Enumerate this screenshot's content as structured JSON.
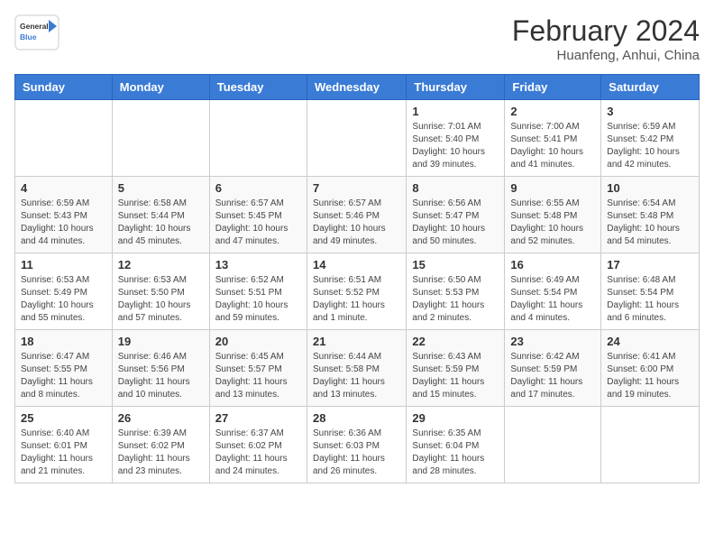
{
  "header": {
    "logo_general": "General",
    "logo_blue": "Blue",
    "month_year": "February 2024",
    "location": "Huanfeng, Anhui, China"
  },
  "days_of_week": [
    "Sunday",
    "Monday",
    "Tuesday",
    "Wednesday",
    "Thursday",
    "Friday",
    "Saturday"
  ],
  "weeks": [
    [
      {
        "day": "",
        "info": ""
      },
      {
        "day": "",
        "info": ""
      },
      {
        "day": "",
        "info": ""
      },
      {
        "day": "",
        "info": ""
      },
      {
        "day": "1",
        "info": "Sunrise: 7:01 AM\nSunset: 5:40 PM\nDaylight: 10 hours and 39 minutes."
      },
      {
        "day": "2",
        "info": "Sunrise: 7:00 AM\nSunset: 5:41 PM\nDaylight: 10 hours and 41 minutes."
      },
      {
        "day": "3",
        "info": "Sunrise: 6:59 AM\nSunset: 5:42 PM\nDaylight: 10 hours and 42 minutes."
      }
    ],
    [
      {
        "day": "4",
        "info": "Sunrise: 6:59 AM\nSunset: 5:43 PM\nDaylight: 10 hours and 44 minutes."
      },
      {
        "day": "5",
        "info": "Sunrise: 6:58 AM\nSunset: 5:44 PM\nDaylight: 10 hours and 45 minutes."
      },
      {
        "day": "6",
        "info": "Sunrise: 6:57 AM\nSunset: 5:45 PM\nDaylight: 10 hours and 47 minutes."
      },
      {
        "day": "7",
        "info": "Sunrise: 6:57 AM\nSunset: 5:46 PM\nDaylight: 10 hours and 49 minutes."
      },
      {
        "day": "8",
        "info": "Sunrise: 6:56 AM\nSunset: 5:47 PM\nDaylight: 10 hours and 50 minutes."
      },
      {
        "day": "9",
        "info": "Sunrise: 6:55 AM\nSunset: 5:48 PM\nDaylight: 10 hours and 52 minutes."
      },
      {
        "day": "10",
        "info": "Sunrise: 6:54 AM\nSunset: 5:48 PM\nDaylight: 10 hours and 54 minutes."
      }
    ],
    [
      {
        "day": "11",
        "info": "Sunrise: 6:53 AM\nSunset: 5:49 PM\nDaylight: 10 hours and 55 minutes."
      },
      {
        "day": "12",
        "info": "Sunrise: 6:53 AM\nSunset: 5:50 PM\nDaylight: 10 hours and 57 minutes."
      },
      {
        "day": "13",
        "info": "Sunrise: 6:52 AM\nSunset: 5:51 PM\nDaylight: 10 hours and 59 minutes."
      },
      {
        "day": "14",
        "info": "Sunrise: 6:51 AM\nSunset: 5:52 PM\nDaylight: 11 hours and 1 minute."
      },
      {
        "day": "15",
        "info": "Sunrise: 6:50 AM\nSunset: 5:53 PM\nDaylight: 11 hours and 2 minutes."
      },
      {
        "day": "16",
        "info": "Sunrise: 6:49 AM\nSunset: 5:54 PM\nDaylight: 11 hours and 4 minutes."
      },
      {
        "day": "17",
        "info": "Sunrise: 6:48 AM\nSunset: 5:54 PM\nDaylight: 11 hours and 6 minutes."
      }
    ],
    [
      {
        "day": "18",
        "info": "Sunrise: 6:47 AM\nSunset: 5:55 PM\nDaylight: 11 hours and 8 minutes."
      },
      {
        "day": "19",
        "info": "Sunrise: 6:46 AM\nSunset: 5:56 PM\nDaylight: 11 hours and 10 minutes."
      },
      {
        "day": "20",
        "info": "Sunrise: 6:45 AM\nSunset: 5:57 PM\nDaylight: 11 hours and 13 minutes."
      },
      {
        "day": "21",
        "info": "Sunrise: 6:44 AM\nSunset: 5:58 PM\nDaylight: 11 hours and 13 minutes."
      },
      {
        "day": "22",
        "info": "Sunrise: 6:43 AM\nSunset: 5:59 PM\nDaylight: 11 hours and 15 minutes."
      },
      {
        "day": "23",
        "info": "Sunrise: 6:42 AM\nSunset: 5:59 PM\nDaylight: 11 hours and 17 minutes."
      },
      {
        "day": "24",
        "info": "Sunrise: 6:41 AM\nSunset: 6:00 PM\nDaylight: 11 hours and 19 minutes."
      }
    ],
    [
      {
        "day": "25",
        "info": "Sunrise: 6:40 AM\nSunset: 6:01 PM\nDaylight: 11 hours and 21 minutes."
      },
      {
        "day": "26",
        "info": "Sunrise: 6:39 AM\nSunset: 6:02 PM\nDaylight: 11 hours and 23 minutes."
      },
      {
        "day": "27",
        "info": "Sunrise: 6:37 AM\nSunset: 6:02 PM\nDaylight: 11 hours and 24 minutes."
      },
      {
        "day": "28",
        "info": "Sunrise: 6:36 AM\nSunset: 6:03 PM\nDaylight: 11 hours and 26 minutes."
      },
      {
        "day": "29",
        "info": "Sunrise: 6:35 AM\nSunset: 6:04 PM\nDaylight: 11 hours and 28 minutes."
      },
      {
        "day": "",
        "info": ""
      },
      {
        "day": "",
        "info": ""
      }
    ]
  ]
}
